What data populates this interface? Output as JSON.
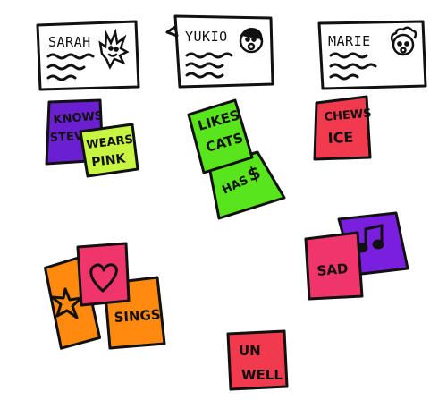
{
  "people": [
    {
      "name": "SARAH",
      "face": "spiky-hair-face-icon"
    },
    {
      "name": "YUKIO",
      "face": "surprised-face-icon"
    },
    {
      "name": "MARIE",
      "face": "curly-hair-face-icon"
    }
  ],
  "notes": {
    "knows_steve": {
      "line1": "KNOWS",
      "line2": "STEVE",
      "color": "#6a1fd0"
    },
    "wears_pink": {
      "line1": "WEARS",
      "line2": "PINK",
      "color": "#c8f542"
    },
    "likes_cats": {
      "line1": "LIKES",
      "line2": "CATS",
      "color": "#59e51b"
    },
    "has_money": {
      "line1": "HAS",
      "symbol": "$",
      "color": "#59e51b"
    },
    "chews_ice": {
      "line1": "CHEWS",
      "line2": "ICE",
      "color": "#f23a4e"
    },
    "sad": {
      "line1": "SAD",
      "color": "#f0356b"
    },
    "music": {
      "icon": "music-note-icon",
      "color": "#7a1ee0"
    },
    "heart": {
      "icon": "heart-icon",
      "color": "#f0356b"
    },
    "star": {
      "icon": "star-icon",
      "color": "#ff8a0f"
    },
    "sings": {
      "line1": "SINGS",
      "color": "#ff8a0f"
    },
    "unwell": {
      "line1": "UN",
      "line2": "WELL",
      "color": "#f23a4e"
    }
  }
}
